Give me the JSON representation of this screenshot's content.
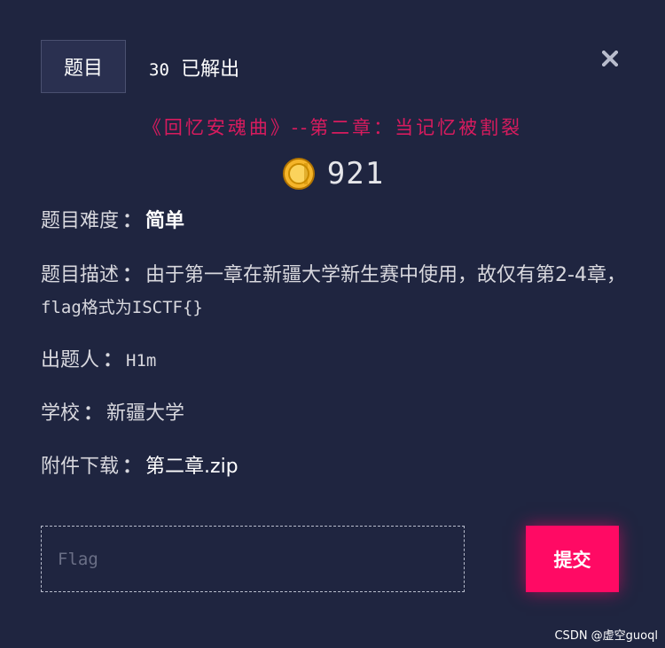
{
  "header": {
    "tab_label": "题目",
    "solves_count": "30",
    "solves_label": "已解出"
  },
  "close_icon": "close-icon",
  "challenge": {
    "name": "《回忆安魂曲》--第二章：当记忆被割裂",
    "points": "921",
    "coin_icon": "coin-icon",
    "colors": {
      "name": "#d81b5e",
      "accent": "#ff0a64",
      "coin": "#f5b52a",
      "background": "#1f2540"
    }
  },
  "info": {
    "sep": "：",
    "difficulty_label": "题目难度",
    "difficulty_value": "简单",
    "description_label": "题目描述",
    "description_value": "由于第一章在新疆大学新生赛中使用，故仅有第2-4章，",
    "description_flag_format": "flag格式为ISCTF{}",
    "author_label": "出题人",
    "author_value": "H1m",
    "school_label": "学校",
    "school_value": "新疆大学",
    "attachment_label": "附件下载",
    "attachment_value": "第二章.zip"
  },
  "form": {
    "flag_placeholder": "Flag",
    "flag_value": "",
    "submit_label": "提交"
  },
  "watermark": "CSDN @虚空guoql"
}
